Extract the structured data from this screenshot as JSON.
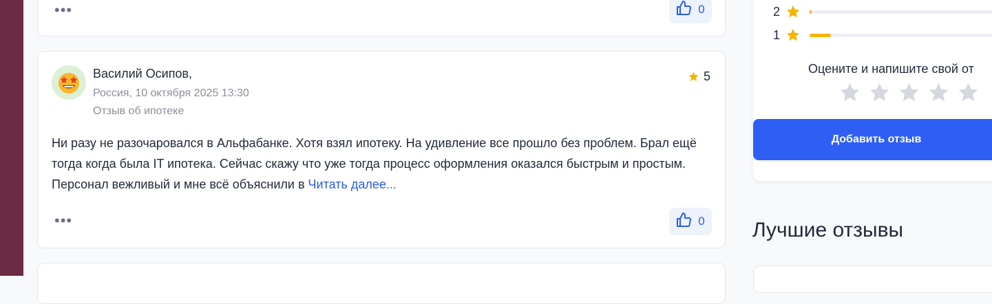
{
  "colors": {
    "accent": "#2b5ce6",
    "star": "#f6b400",
    "sidebar": "#6b2b42",
    "button": "#2f5ef5"
  },
  "prev_review": {
    "more_label": "•••",
    "likes": "0"
  },
  "review": {
    "author": "Василий Осипов,",
    "location_date": "Россия, 10 октября 2025 13:30",
    "category": "Отзыв об ипотеке",
    "rating": "5",
    "text": "Ни разу не разочаровался в Альфабанке. Хотя взял ипотеку. На удивление все прошло без проблем. Брал ещё тогда когда была IT ипотека. Сейчас скажу что уже тогда процесс оформления оказался быстрым и простым. Персонал вежливый и мне всё объяснили в ",
    "read_more": "Читать далее...",
    "more_label": "•••",
    "likes": "0",
    "avatar_icon": "star-struck-emoji-icon"
  },
  "rating_distribution": [
    {
      "stars": "2",
      "fill": 0.005
    },
    {
      "stars": "1",
      "fill": 0.11
    }
  ],
  "rate_prompt": "Оцените и напишите свой от",
  "add_review_label": "Добавить отзыв",
  "best_reviews_title": "Лучшие отзывы"
}
